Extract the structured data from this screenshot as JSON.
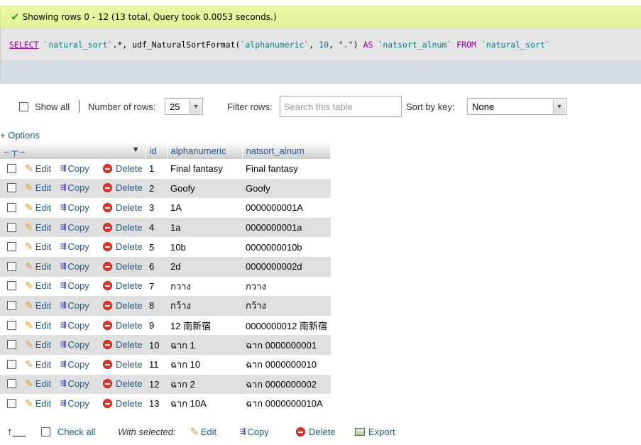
{
  "status": {
    "icon": "check-icon",
    "message": "Showing rows 0 - 12 (13 total, Query took 0.0053 seconds.)"
  },
  "sql": {
    "tokens": [
      {
        "t": "SELECT",
        "c": "kw"
      },
      {
        "t": " ",
        "c": ""
      },
      {
        "t": "`natural_sort`",
        "c": "id"
      },
      {
        "t": ".*, udf_NaturalSortFormat(",
        "c": "fn"
      },
      {
        "t": "`alphanumeric`",
        "c": "id"
      },
      {
        "t": ", ",
        "c": "fn"
      },
      {
        "t": "10",
        "c": "num"
      },
      {
        "t": ", ",
        "c": "fn"
      },
      {
        "t": "\".\"",
        "c": "str"
      },
      {
        "t": ") ",
        "c": "fn"
      },
      {
        "t": "AS",
        "c": "kw2"
      },
      {
        "t": " ",
        "c": ""
      },
      {
        "t": "`natsort_alnum`",
        "c": "id"
      },
      {
        "t": " ",
        "c": ""
      },
      {
        "t": "FROM",
        "c": "kw2"
      },
      {
        "t": " ",
        "c": ""
      },
      {
        "t": "`natural_sort`",
        "c": "id"
      }
    ]
  },
  "controls": {
    "show_all_label": "Show all",
    "num_rows_label": "Number of rows:",
    "num_rows_value": "25",
    "filter_label": "Filter rows:",
    "filter_placeholder": "Search this table",
    "sort_label": "Sort by key:",
    "sort_value": "None"
  },
  "options_link": "+ Options",
  "table": {
    "columns": [
      "id",
      "alphanumeric",
      "natsort_alnum"
    ],
    "actions": {
      "edit": "Edit",
      "copy": "Copy",
      "delete": "Delete"
    },
    "rows": [
      {
        "id": "1",
        "alphanumeric": "Final fantasy",
        "natsort_alnum": "Final fantasy"
      },
      {
        "id": "2",
        "alphanumeric": "Goofy",
        "natsort_alnum": "Goofy"
      },
      {
        "id": "3",
        "alphanumeric": "1A",
        "natsort_alnum": "0000000001A"
      },
      {
        "id": "4",
        "alphanumeric": "1a",
        "natsort_alnum": "0000000001a"
      },
      {
        "id": "5",
        "alphanumeric": "10b",
        "natsort_alnum": "0000000010b"
      },
      {
        "id": "6",
        "alphanumeric": "2d",
        "natsort_alnum": "0000000002d"
      },
      {
        "id": "7",
        "alphanumeric": "กวาง",
        "natsort_alnum": "กวาง"
      },
      {
        "id": "8",
        "alphanumeric": "กว้าง",
        "natsort_alnum": "กว้าง"
      },
      {
        "id": "9",
        "alphanumeric": "12 南新宿",
        "natsort_alnum": "0000000012 南新宿"
      },
      {
        "id": "10",
        "alphanumeric": "ฉาก 1",
        "natsort_alnum": "ฉาก 0000000001"
      },
      {
        "id": "11",
        "alphanumeric": "ฉาก 10",
        "natsort_alnum": "ฉาก 0000000010"
      },
      {
        "id": "12",
        "alphanumeric": "ฉาก 2",
        "natsort_alnum": "ฉาก 0000000002"
      },
      {
        "id": "13",
        "alphanumeric": "ฉาก 10A",
        "natsort_alnum": "ฉาก 0000000010A"
      }
    ]
  },
  "bottom": {
    "check_all": "Check all",
    "with_selected": "With selected:",
    "edit": "Edit",
    "copy": "Copy",
    "delete": "Delete",
    "export": "Export"
  }
}
